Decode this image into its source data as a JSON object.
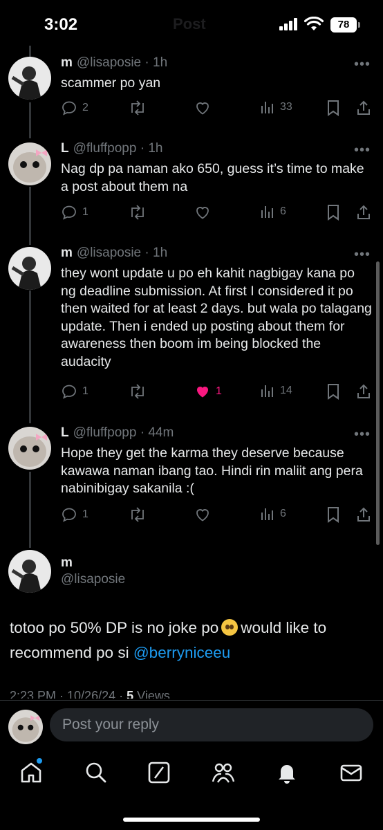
{
  "status_bar": {
    "time": "3:02",
    "battery": "78",
    "header_title_ghost": "Post"
  },
  "replies": [
    {
      "name": "m",
      "handle": "@lisaposie",
      "time": "· 1h",
      "text": "scammer po yan",
      "replies": "2",
      "reposts": "",
      "likes": "",
      "views": "33",
      "liked": false
    },
    {
      "name": "L",
      "handle": "@fluffpopp",
      "time": "· 1h",
      "text": "Nag dp pa naman ako 650, guess it’s time to make a post about them na",
      "replies": "1",
      "reposts": "",
      "likes": "",
      "views": "6",
      "liked": false
    },
    {
      "name": "m",
      "handle": "@lisaposie",
      "time": "· 1h",
      "text": "they wont update u po eh kahit nagbigay kana po ng deadline submission. At first I considered it po then waited for at least 2 days. but wala po talagang update. Then i ended up posting about them for awareness then boom im being blocked the audacity",
      "replies": "1",
      "reposts": "",
      "likes": "1",
      "views": "14",
      "liked": true
    },
    {
      "name": "L",
      "handle": "@fluffpopp",
      "time": "· 44m",
      "text": "Hope they get the karma they deserve because kawawa naman ibang tao. Hindi rin maliit ang pera nabinibigay sakanila :(",
      "replies": "1",
      "reposts": "",
      "likes": "",
      "views": "6",
      "liked": false
    }
  ],
  "main_post": {
    "name": "m",
    "handle": "@lisaposie",
    "text_before": "totoo po 50% DP is no joke po",
    "emoji": "pleading-face",
    "text_after": "would like to recommend po si",
    "mention": "@berryniceeu",
    "timestamp": "2:23 PM · 10/26/24 ·",
    "views_count": "5",
    "views_label": "Views"
  },
  "reply_box": {
    "placeholder": "Post your reply"
  },
  "tabs": [
    "home",
    "search",
    "grok",
    "communities",
    "notifications",
    "messages"
  ],
  "colors": {
    "accent": "#1d9bf0",
    "like": "#f91880",
    "muted": "#71767b",
    "background": "#000000"
  }
}
